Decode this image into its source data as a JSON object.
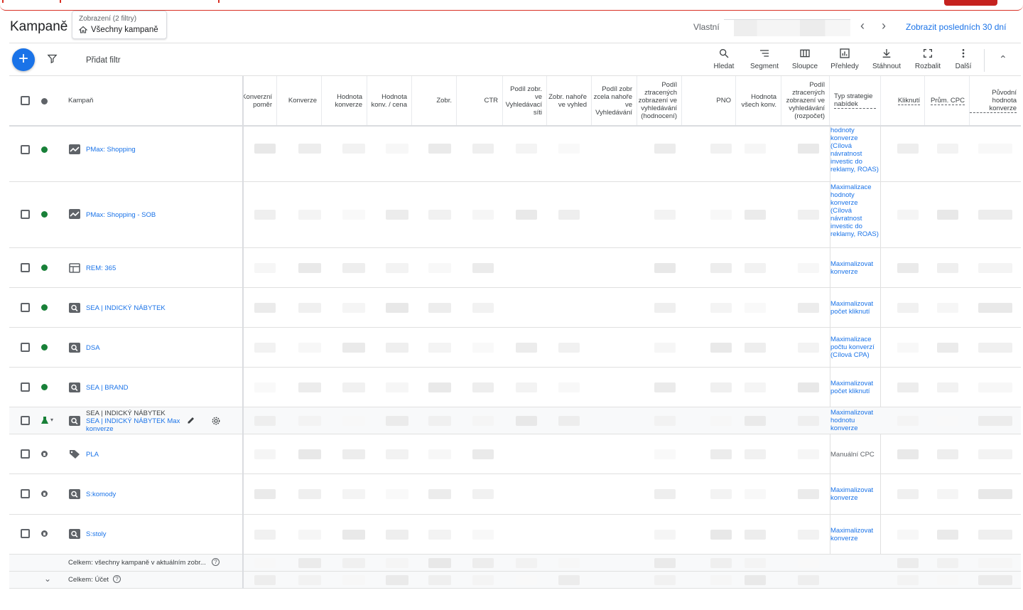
{
  "header": {
    "title": "Kampaně",
    "view_label": "Zobrazení (2 filtry)",
    "view_value": "Všechny kampaně",
    "date_label": "Vlastní",
    "last_period_link": "Zobrazit posledních 30 dní"
  },
  "toolbar": {
    "add_filter": "Přidat filtr",
    "search": "Hledat",
    "segment": "Segment",
    "columns": "Sloupce",
    "reports": "Přehledy",
    "download": "Stáhnout",
    "expand": "Rozbalit",
    "more": "Další"
  },
  "table": {
    "col_campaign": "Kampaň",
    "columns": [
      "Konverzní poměr",
      "Konverze",
      "Hodnota konverze",
      "Hodnota konv. / cena",
      "Zobr.",
      "CTR",
      "Podíl zobr. ve Vyhledávací síti",
      "Zobr. nahoře ve vyhled",
      "Podíl zobr zcela nahoře ve Vyhledávání",
      "Podíl ztracených zobrazení ve vyhledávání (hodnocení)",
      "PNO",
      "Hodnota všech konv.",
      "Podíl ztracených zobrazení ve vyhledávání (rozpočet)",
      "Typ strategie nabídek",
      "Kliknutí",
      "Prům. CPC",
      "Původní hodnota konverze"
    ],
    "rows": [
      {
        "name": "PMax: Shopping",
        "status": "green",
        "type_icon": "performance-max-icon",
        "bid": "hodnoty konverze (Cílová návratnost investic do reklamy, ROAS)"
      },
      {
        "name": "PMax: Shopping - SOB",
        "status": "green",
        "type_icon": "performance-max-icon",
        "bid": "Maximalizace hodnoty konverze (Cílová návratnost investic do reklamy, ROAS)"
      },
      {
        "name": "REM: 365",
        "status": "green",
        "type_icon": "display-icon",
        "bid": "Maximalizovat konverze"
      },
      {
        "name": "SEA | INDICKÝ NÁBYTEK",
        "status": "green",
        "type_icon": "search-campaign-icon",
        "bid": "Maximalizovat počet kliknutí"
      },
      {
        "name": "DSA",
        "status": "green",
        "type_icon": "search-campaign-icon",
        "bid": "Maximalizace počtu konverzí (Cílová CPA)"
      },
      {
        "name": "SEA | BRAND",
        "status": "green",
        "type_icon": "search-campaign-icon",
        "bid": "Maximalizovat počet kliknutí"
      },
      {
        "name_top": "SEA | INDICKÝ NÁBYTEK",
        "name": "SEA | INDICKÝ NÁBYTEK Max konverze",
        "status": "experiment",
        "type_icon": "search-campaign-icon",
        "bid": "Maximalizovat hodnotu konverze"
      },
      {
        "name": "PLA",
        "status": "paused",
        "type_icon": "shopping-tag-icon",
        "bid": "Manuální CPC"
      },
      {
        "name": "S:komody",
        "status": "paused",
        "type_icon": "search-campaign-icon",
        "bid": "Maximalizovat konverze"
      },
      {
        "name": "S:stoly",
        "status": "paused",
        "type_icon": "search-campaign-icon",
        "bid": "Maximalizovat konverze"
      }
    ],
    "total_view": "Celkem: všechny kampaně v aktuálním zobr...",
    "total_account": "Celkem: Účet"
  },
  "colors": {
    "accent": "#1a73e8",
    "enabled": "#188038",
    "alert": "#d93025"
  }
}
